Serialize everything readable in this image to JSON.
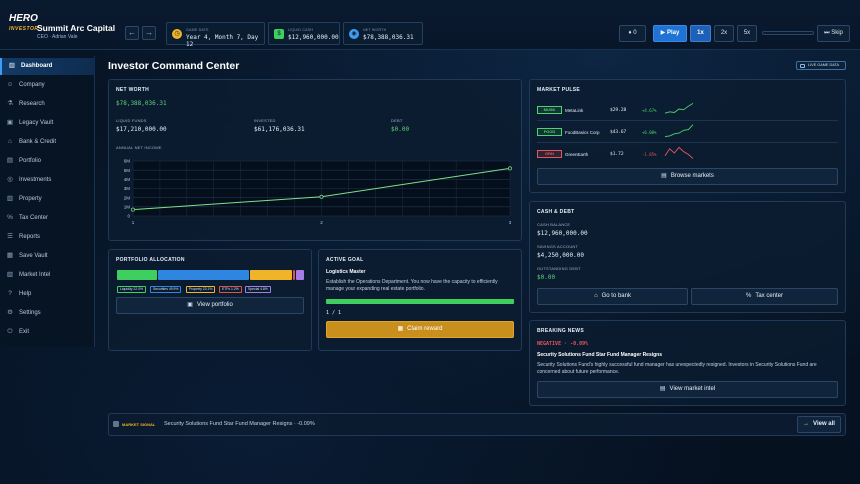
{
  "header": {
    "logo_line1": "HERO",
    "logo_line2": "INVESTOR",
    "company_name": "Summit Arc Capital",
    "ceo": "CEO · Adrian Vale",
    "game_date_label": "GAME DATE",
    "game_date": "Year 4, Month 7, Day 12",
    "liquid_cash_label": "LIQUID CASH",
    "liquid_cash": "$12,960,000.00",
    "net_worth_label": "NET WORTH",
    "net_worth": "$78,388,036.31",
    "alerts_count": "0",
    "play_label": "Play",
    "speed_options": [
      "1x",
      "2x",
      "5x"
    ],
    "speed_selected": "1x",
    "skip_label": "Skip"
  },
  "sidebar": {
    "items": [
      {
        "label": "Dashboard",
        "icon": "chart-icon"
      },
      {
        "label": "Company",
        "icon": "people-icon"
      },
      {
        "label": "Research",
        "icon": "flask-icon"
      },
      {
        "label": "Legacy Vault",
        "icon": "vault-icon"
      },
      {
        "label": "Bank & Credit",
        "icon": "bank-icon"
      },
      {
        "label": "Portfolio",
        "icon": "briefcase-icon"
      },
      {
        "label": "Investments",
        "icon": "coins-icon"
      },
      {
        "label": "Property",
        "icon": "building-icon"
      },
      {
        "label": "Tax Center",
        "icon": "percent-icon"
      },
      {
        "label": "Reports",
        "icon": "document-icon"
      },
      {
        "label": "Save Vault",
        "icon": "save-icon"
      },
      {
        "label": "Market Intel",
        "icon": "newspaper-icon"
      },
      {
        "label": "Help",
        "icon": "question-icon"
      },
      {
        "label": "Settings",
        "icon": "gear-icon"
      },
      {
        "label": "Exit",
        "icon": "exit-icon"
      }
    ],
    "active_index": 0
  },
  "main": {
    "title": "Investor Command Center",
    "live_badge": "LIVE GAME DATA"
  },
  "net_worth_panel": {
    "title": "NET WORTH",
    "net_worth": "$78,388,036.31",
    "liquid_label": "LIQUID FUNDS",
    "liquid": "$17,210,000.00",
    "invested_label": "INVESTED",
    "invested": "$61,176,036.31",
    "debt_label": "DEBT",
    "debt": "$0.00",
    "chart_label": "ANNUAL NET INCOME"
  },
  "chart_data": {
    "type": "line",
    "title": "ANNUAL NET INCOME",
    "x": [
      1,
      2,
      3
    ],
    "y": [
      0.7,
      2.1,
      5.2
    ],
    "y_tick_labels": [
      "0",
      "1M",
      "2M",
      "3M",
      "4M",
      "5M",
      "6M"
    ],
    "x_tick_labels": [
      "1",
      "2",
      "3"
    ],
    "xlim": [
      1,
      3
    ],
    "ylim": [
      0,
      6
    ],
    "grid": true,
    "line_color": "#7fe08a"
  },
  "portfolio_panel": {
    "title": "PORTFOLIO ALLOCATION",
    "segments": [
      {
        "label": "Liquidity 22.0%",
        "fraction": 0.22,
        "color": "#3fcf5f"
      },
      {
        "label": "Securities 49.9%",
        "fraction": 0.499,
        "color": "#2f86e0"
      },
      {
        "label": "Property 23.1%",
        "fraction": 0.231,
        "color": "#f0b429"
      },
      {
        "label": "ETFs 1.2%",
        "fraction": 0.012,
        "color": "#e0524a"
      },
      {
        "label": "Special 4.8%",
        "fraction": 0.048,
        "color": "#a57be6"
      }
    ],
    "view_button": "View portfolio"
  },
  "goal_panel": {
    "title": "ACTIVE GOAL",
    "goal_name": "Logistics Master",
    "description": "Establish the Operations Department. You now have the capacity to efficiently manage your expanding real estate portfolio.",
    "progress": 1.0,
    "progress_text": "1 / 1",
    "claim_button": "Claim reward"
  },
  "market_pulse": {
    "title": "MARKET PULSE",
    "tickers": [
      {
        "tag": "MUSK",
        "name": "MetaLink",
        "price": "$29.28",
        "change": "+4.67%",
        "color": "#4fd26e",
        "trend": [
          0.2,
          0.3,
          0.25,
          0.5,
          0.45,
          0.7,
          0.9
        ]
      },
      {
        "tag": "FOOD",
        "name": "FoodBasics Corp",
        "price": "$43.67",
        "change": "+6.00%",
        "color": "#4fd26e",
        "trend": [
          0.1,
          0.15,
          0.3,
          0.35,
          0.55,
          0.6,
          0.95
        ]
      },
      {
        "tag": "GRN",
        "name": "GreenEarth",
        "price": "$1.72",
        "change": "-1.85%",
        "color": "#e8555b",
        "trend": [
          0.3,
          0.8,
          0.5,
          0.9,
          0.6,
          0.4,
          0.1
        ]
      }
    ],
    "browse_button": "Browse markets"
  },
  "cash_panel": {
    "title": "CASH & DEBT",
    "cash_label": "CASH BALANCE",
    "cash": "$12,960,000.00",
    "savings_label": "SAVINGS ACCOUNT",
    "savings": "$4,250,000.00",
    "debt_label": "OUTSTANDING DEBT",
    "debt": "$0.00",
    "bank_button": "Go to bank",
    "tax_button": "Tax center"
  },
  "news_panel": {
    "title": "BREAKING NEWS",
    "sentiment": "NEGATIVE · -0.09%",
    "headline": "Security Solutions Fund Star Fund Manager Resigns",
    "body": "Security Solutions Fund's highly successful fund manager has unexpectedly resigned. Investors in Security Solutions Fund are concerned about future performance.",
    "intel_button": "View market intel"
  },
  "signal_bar": {
    "label": "MARKET SIGNAL",
    "text": "Security Solutions Fund Star Fund Manager Resigns · -0.09%",
    "view_all": "View all"
  },
  "colors": {
    "accent": "#1e73d4",
    "positive": "#5fd27b",
    "negative": "#e8555b",
    "gold": "#d89b20"
  }
}
